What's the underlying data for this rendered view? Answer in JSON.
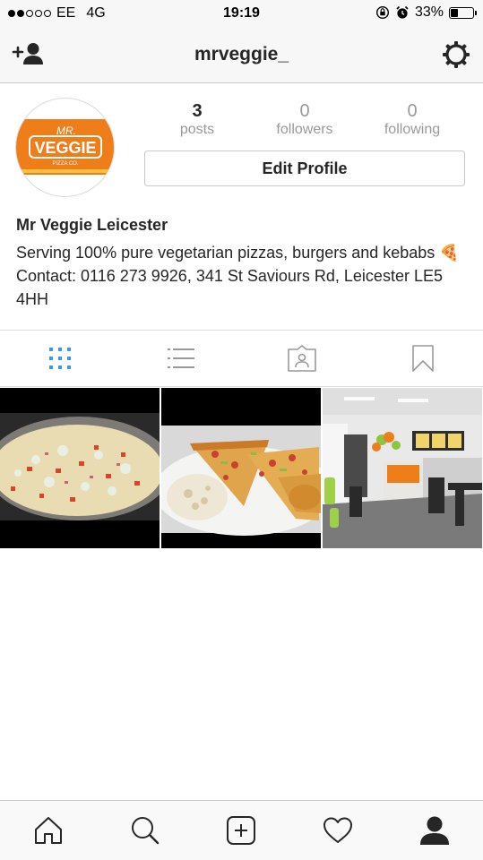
{
  "status_bar": {
    "carrier": "EE",
    "network": "4G",
    "time": "19:19",
    "battery": "33%",
    "battery_level": 0.33,
    "signal_bars": 2
  },
  "header": {
    "username": "mrveggie_"
  },
  "avatar": {
    "logo_text_mr": "MR.",
    "logo_text_veggie": "VEGGIE",
    "logo_subtext": "PIZZA CO.",
    "brand_color": "#ee7d1a"
  },
  "stats": [
    {
      "value": "3",
      "label": "posts"
    },
    {
      "value": "0",
      "label": "followers"
    },
    {
      "value": "0",
      "label": "following"
    }
  ],
  "edit_profile_label": "Edit Profile",
  "bio": {
    "name": "Mr Veggie Leicester",
    "text": "Serving 100% pure vegetarian pizzas, burgers and kebabs 🍕 Contact: 0116 273 9926, 341 St Saviours Rd, Leicester LE5 4HH"
  },
  "tabs": [
    {
      "icon": "grid-icon",
      "active": true
    },
    {
      "icon": "list-icon",
      "active": false
    },
    {
      "icon": "tagged-icon",
      "active": false
    },
    {
      "icon": "bookmark-icon",
      "active": false
    }
  ],
  "posts": [
    {
      "subject": "pizza in pan"
    },
    {
      "subject": "pizza slices on plate"
    },
    {
      "subject": "restaurant interior"
    }
  ],
  "bottom_nav": [
    {
      "icon": "home-icon"
    },
    {
      "icon": "search-icon"
    },
    {
      "icon": "add-post-icon"
    },
    {
      "icon": "heart-icon"
    },
    {
      "icon": "profile-icon"
    }
  ],
  "colors": {
    "active_tab": "#3897f0",
    "inactive_icon": "#999999",
    "text": "#262626"
  }
}
